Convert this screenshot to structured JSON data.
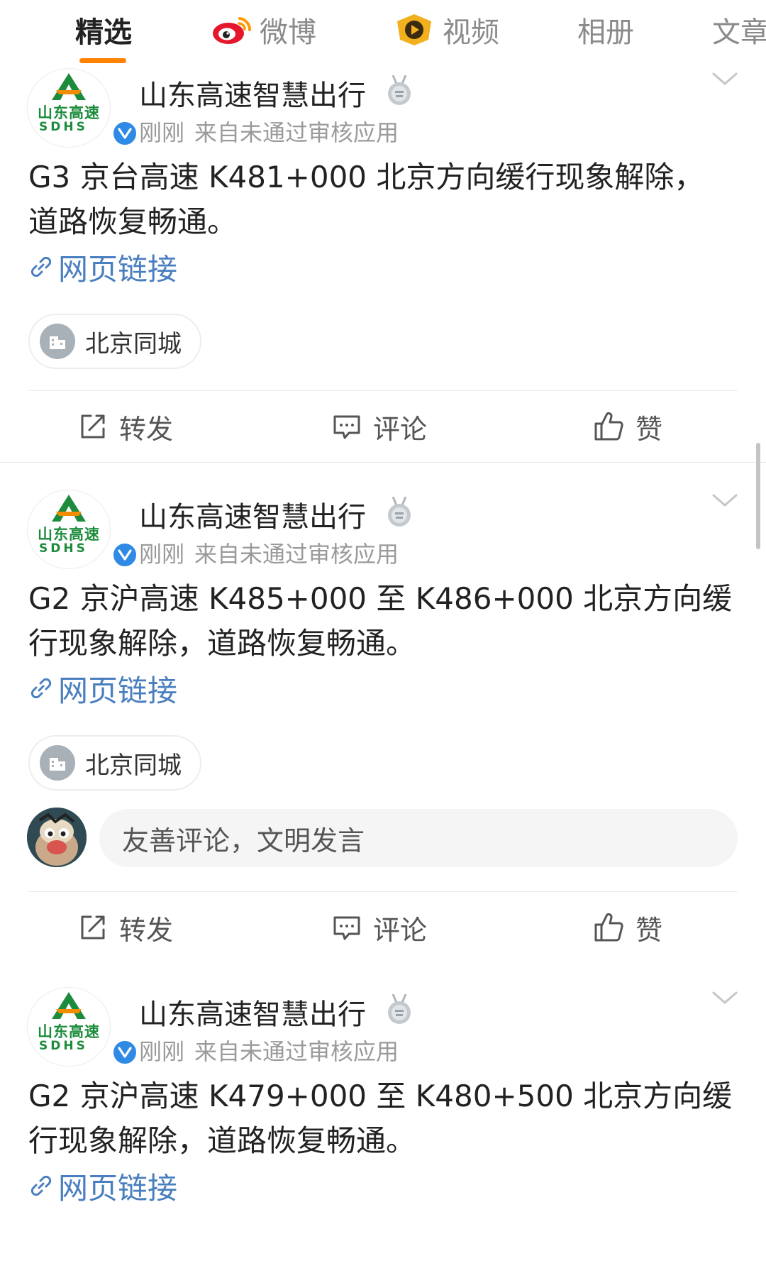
{
  "tabs": [
    {
      "label": "精选",
      "active": true
    },
    {
      "label": "微博",
      "icon": "weibo-logo-icon"
    },
    {
      "label": "视频",
      "icon": "video-play-icon"
    },
    {
      "label": "相册"
    },
    {
      "label": "文章"
    }
  ],
  "colors": {
    "accent": "#ff8200",
    "link": "#4a7fbf",
    "verified": "#2f8ae5",
    "logo_green": "#1c8c3c",
    "logo_orange": "#f28c00"
  },
  "posts": [
    {
      "author": "山东高速智慧出行",
      "avatar_logo_line1": "山东高速",
      "avatar_logo_line2": "SDHS",
      "time": "刚刚",
      "source": "来自未通过审核应用",
      "text_line1": "G3 京台高速 K481+000 北京方向缓行现象解除，",
      "text_line2": "道路恢复畅通。",
      "link_label": "网页链接",
      "location": "北京同城",
      "actions": {
        "repost": "转发",
        "comment": "评论",
        "like": "赞"
      }
    },
    {
      "author": "山东高速智慧出行",
      "avatar_logo_line1": "山东高速",
      "avatar_logo_line2": "SDHS",
      "time": "刚刚",
      "source": "来自未通过审核应用",
      "text_line1": "G2 京沪高速 K485+000 至 K486+000 北京方向缓",
      "text_line2": "行现象解除，道路恢复畅通。",
      "link_label": "网页链接",
      "location": "北京同城",
      "comment_placeholder": "友善评论，文明发言",
      "actions": {
        "repost": "转发",
        "comment": "评论",
        "like": "赞"
      }
    },
    {
      "author": "山东高速智慧出行",
      "avatar_logo_line1": "山东高速",
      "avatar_logo_line2": "SDHS",
      "time": "刚刚",
      "source": "来自未通过审核应用",
      "text_line1": "G2 京沪高速 K479+000 至 K480+500 北京方向缓",
      "text_line2": "行现象解除，道路恢复畅通。",
      "link_label": "网页链接"
    }
  ]
}
